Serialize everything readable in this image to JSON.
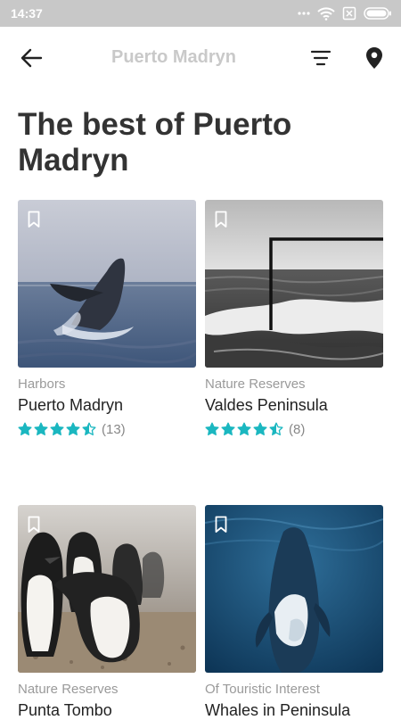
{
  "status_bar": {
    "time": "14:37"
  },
  "toolbar": {
    "title": "Puerto Madryn"
  },
  "page": {
    "title": "The best of Puerto Madryn"
  },
  "colors": {
    "star": "#1bb7c0",
    "title_faded": "#c9c9c9",
    "status_bar": "#c8c8c8"
  },
  "cards": [
    {
      "category": "Harbors",
      "title": "Puerto Madryn",
      "rating": 4.5,
      "reviews": "(13)",
      "image": "whale-breaching-photo"
    },
    {
      "category": "Nature Reserves",
      "title": "Valdes Peninsula",
      "rating": 4.5,
      "reviews": "(8)",
      "image": "ocean-waves-bw-photo"
    },
    {
      "category": "Nature Reserves",
      "title": "Punta Tombo",
      "image": "penguins-photo"
    },
    {
      "category": "Of Touristic Interest",
      "title": "Whales in Peninsula",
      "image": "whale-underwater-photo"
    }
  ]
}
